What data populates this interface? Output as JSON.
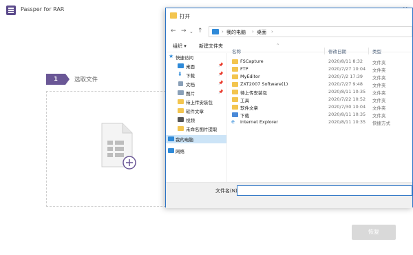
{
  "app": {
    "title": "Passper for RAR",
    "step_number": "1",
    "step_label": "选取文件",
    "next_button": "恢复"
  },
  "dialog": {
    "title": "打开",
    "breadcrumbs": [
      "我的电脑",
      "桌面"
    ],
    "toolbar": {
      "organize": "组织 ▾",
      "new_folder": "新建文件夹"
    },
    "nav": [
      {
        "label": "快速访问",
        "icon": "star-icon",
        "color": "#2f8ad8"
      },
      {
        "label": "桌面",
        "icon": "desktop-icon",
        "color": "#2f8ad8",
        "pin": "📌"
      },
      {
        "label": "下载",
        "icon": "download-icon",
        "color": "#2f8ad8",
        "pin": "📌"
      },
      {
        "label": "文档",
        "icon": "document-icon",
        "color": "#8aa0b8",
        "pin": "📌"
      },
      {
        "label": "图片",
        "icon": "picture-icon",
        "color": "#8aa0b8",
        "pin": "📌"
      },
      {
        "label": "待上传安装包",
        "icon": "folder-icon",
        "color": "#f3c54f"
      },
      {
        "label": "软件文章",
        "icon": "folder-icon",
        "color": "#f3c54f"
      },
      {
        "label": "视频",
        "icon": "video-icon",
        "color": "#555555"
      },
      {
        "label": "未命名图片提取",
        "icon": "folder-icon",
        "color": "#f3c54f"
      },
      {
        "label": "我的电脑",
        "icon": "computer-icon",
        "color": "#2f8ad8"
      },
      {
        "label": "网络",
        "icon": "network-icon",
        "color": "#2f8ad8"
      }
    ],
    "columns": {
      "name": "名称",
      "date": "修改日期",
      "type": "类型"
    },
    "files": [
      {
        "name": "FSCapture",
        "date": "2020/8/11 8:32",
        "type": "文件夹"
      },
      {
        "name": "FTP",
        "date": "2020/7/27 10:04",
        "type": "文件夹"
      },
      {
        "name": "MyEditor",
        "date": "2020/7/2 17:39",
        "type": "文件夹"
      },
      {
        "name": "ZXT2007 Software(1)",
        "date": "2020/7/27 9:48",
        "type": "文件夹"
      },
      {
        "name": "待上传安装包",
        "date": "2020/8/11 10:35",
        "type": "文件夹"
      },
      {
        "name": "工具",
        "date": "2020/7/22 10:52",
        "type": "文件夹"
      },
      {
        "name": "软件文章",
        "date": "2020/7/30 10:04",
        "type": "文件夹"
      },
      {
        "name": "下载",
        "date": "2020/8/11 10:35",
        "type": "文件夹"
      },
      {
        "name": "Internet  Explorer",
        "date": "2020/8/11 10:35",
        "type": "快捷方式"
      }
    ],
    "filename_label": "文件名(N):",
    "filename_value": ""
  }
}
